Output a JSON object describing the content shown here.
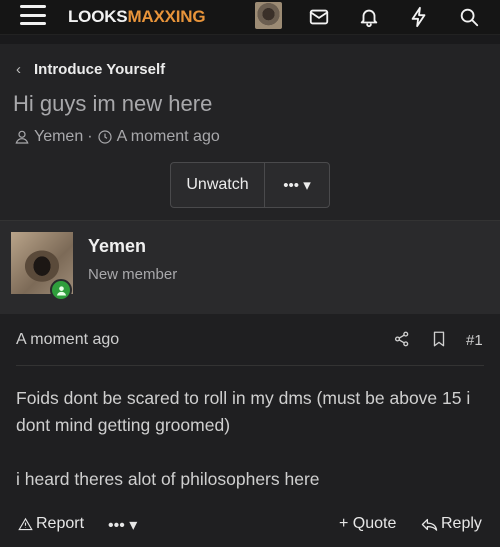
{
  "header": {
    "logo_part1": "LOOKS",
    "logo_part2": "MAXXING",
    "icons": [
      "menu-icon",
      "avatar",
      "mail-icon",
      "bell-icon",
      "bolt-icon",
      "search-icon"
    ]
  },
  "thread": {
    "breadcrumb": "Introduce Yourself",
    "title": "Hi guys im new here",
    "author": "Yemen",
    "separator": "·",
    "time": "A moment ago",
    "unwatch_label": "Unwatch",
    "more_label": "•••",
    "more_caret": "▾"
  },
  "post": {
    "username": "Yemen",
    "user_title": "New member",
    "time": "A moment ago",
    "number": "#1",
    "paragraphs": [
      "Foids dont be scared to roll in my dms (must be above 15 i dont mind getting groomed)",
      "i heard theres alot of philosophers here"
    ],
    "actions": {
      "report": "Report",
      "more": "•••",
      "more_caret": "▾",
      "quote": "+ Quote",
      "reply": "Reply"
    }
  },
  "colors": {
    "accent": "#e8943a",
    "online": "#2f9e3c"
  }
}
